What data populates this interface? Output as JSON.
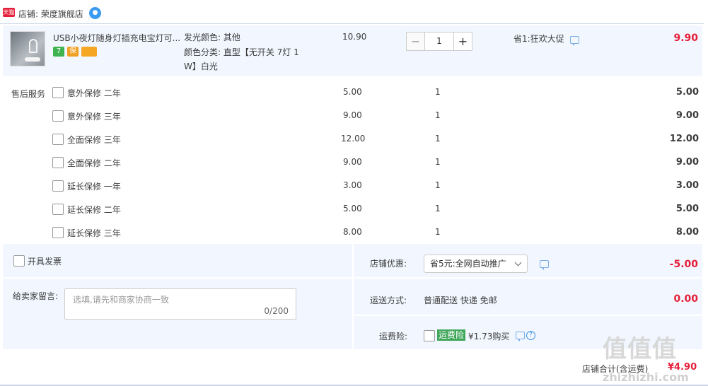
{
  "shop": {
    "badge": "天猫",
    "label": "店铺: 荣度旗舰店",
    "wangwang_icon": "wangwang-chat-icon"
  },
  "item": {
    "title": "USB小夜灯随身灯插充电宝灯可...",
    "badges": [
      "7",
      "保",
      "卡"
    ],
    "sku_color_label": "发光颜色: 其他",
    "sku_type_line1": "颜色分类: 直型【无开关 7灯 1",
    "sku_type_line2": "W】白光",
    "unit_price": "10.90",
    "qty": "1",
    "qty_minus": "−",
    "qty_plus": "+",
    "promo": "省1:狂欢大促",
    "subtotal": "9.90"
  },
  "services": {
    "label": "售后服务",
    "items": [
      {
        "name": "意外保修 二年",
        "price": "5.00",
        "qty": "1",
        "total": "5.00"
      },
      {
        "name": "意外保修 三年",
        "price": "9.00",
        "qty": "1",
        "total": "9.00"
      },
      {
        "name": "全面保修 三年",
        "price": "12.00",
        "qty": "1",
        "total": "12.00"
      },
      {
        "name": "全面保修 二年",
        "price": "9.00",
        "qty": "1",
        "total": "9.00"
      },
      {
        "name": "延长保修 一年",
        "price": "3.00",
        "qty": "1",
        "total": "3.00"
      },
      {
        "name": "延长保修 二年",
        "price": "5.00",
        "qty": "1",
        "total": "5.00"
      },
      {
        "name": "延长保修 三年",
        "price": "8.00",
        "qty": "1",
        "total": "8.00"
      }
    ]
  },
  "invoice": {
    "label": "开具发票"
  },
  "message": {
    "label": "给卖家留言:",
    "placeholder": "选填,请先和商家协商一致",
    "counter": "0/200"
  },
  "discount": {
    "label": "店铺优惠:",
    "selected": "省5元:全网自动推广",
    "amount": "-5.00"
  },
  "shipping": {
    "label": "运送方式:",
    "value": "普通配送 快递 免邮",
    "amount": "0.00"
  },
  "insurance": {
    "label": "运费险:",
    "tag": "运费险",
    "text": "¥1.73购买"
  },
  "total": {
    "label": "店铺合计(含运费)",
    "amount": "¥4.90"
  },
  "watermark": {
    "chars": "值值值",
    "site": "zhizhizhi.com"
  },
  "colors": {
    "accent_red": "#e5203a",
    "panel_bg": "#f2f7ff",
    "link_blue": "#3a8ee6",
    "tag_green": "#3fa65a"
  }
}
